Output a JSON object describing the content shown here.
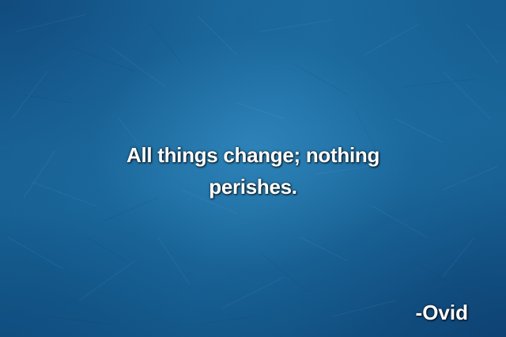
{
  "quote": {
    "text": "All things change; nothing perishes.",
    "author": "-Ovid"
  },
  "theme": {
    "background": "#1a6a9c",
    "text_color": "#ffffff"
  }
}
